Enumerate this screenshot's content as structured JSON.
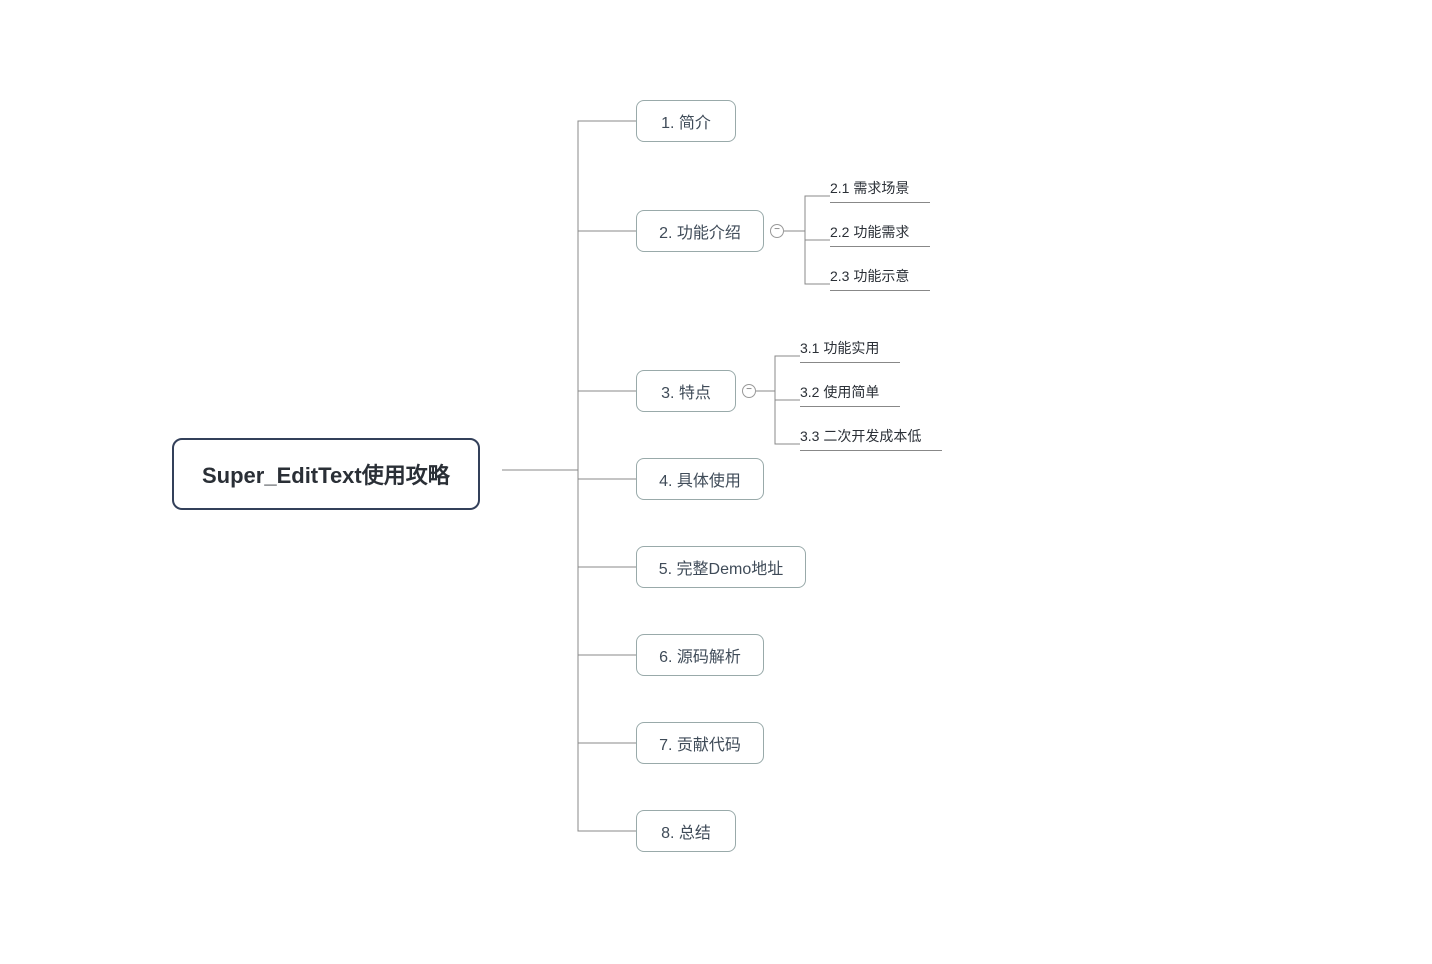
{
  "mindmap": {
    "root": {
      "label": "Super_EditText使用攻略"
    },
    "nodes": {
      "n1": {
        "label": "1. 简介"
      },
      "n2": {
        "label": "2. 功能介绍"
      },
      "n3": {
        "label": "3. 特点"
      },
      "n4": {
        "label": "4. 具体使用"
      },
      "n5": {
        "label": "5. 完整Demo地址"
      },
      "n6": {
        "label": "6. 源码解析"
      },
      "n7": {
        "label": "7. 贡献代码"
      },
      "n8": {
        "label": "8. 总结"
      }
    },
    "leaves": {
      "l21": {
        "label": "2.1 需求场景"
      },
      "l22": {
        "label": "2.2 功能需求"
      },
      "l23": {
        "label": "2.3 功能示意"
      },
      "l31": {
        "label": "3.1 功能实用"
      },
      "l32": {
        "label": "3.2 使用简单"
      },
      "l33": {
        "label": "3.3 二次开发成本低"
      }
    }
  }
}
